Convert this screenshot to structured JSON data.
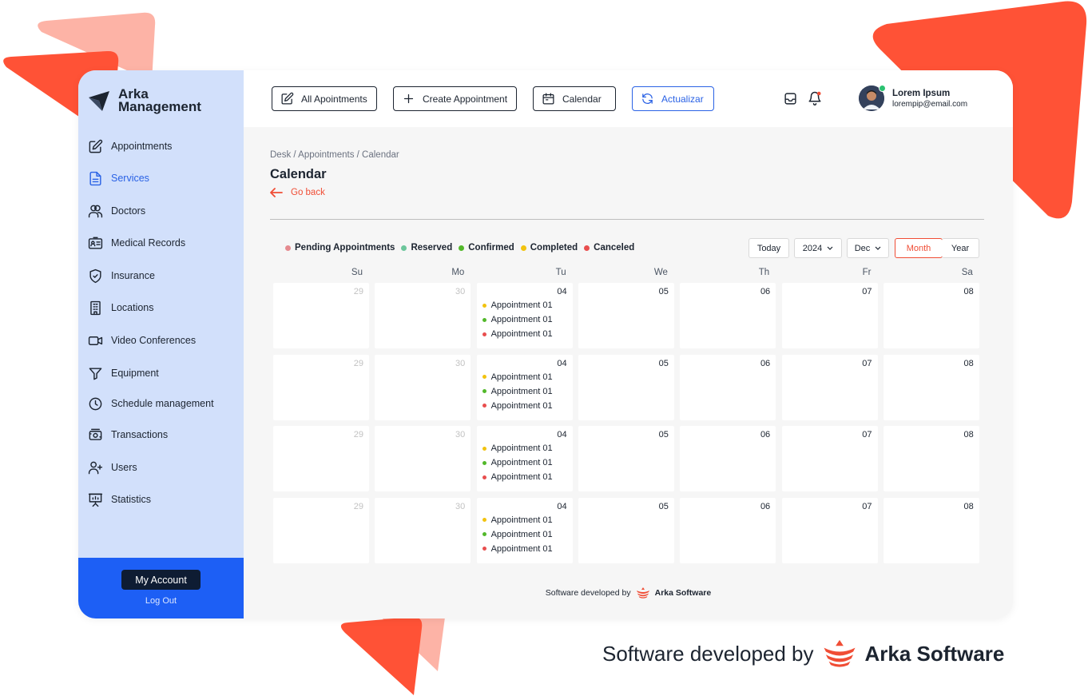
{
  "colors": {
    "accent": "#f04d35",
    "accent_light": "#fdb3a6",
    "sidebar_bg": "#d2e0fb",
    "primary_blue": "#1d5ff5",
    "pending": "#e58a8f",
    "reserved": "#6cc69b",
    "confirmed": "#52b82a",
    "completed": "#f2c30f",
    "canceled": "#e84e4e"
  },
  "sidebar": {
    "brand": "Arka Management",
    "items": [
      {
        "label": "Appointments",
        "icon": "edit-icon"
      },
      {
        "label": "Services",
        "icon": "document-icon",
        "active": true
      },
      {
        "label": "Doctors",
        "icon": "users-icon"
      },
      {
        "label": "Medical Records",
        "icon": "id-card-icon"
      },
      {
        "label": "Insurance",
        "icon": "shield-icon"
      },
      {
        "label": "Locations",
        "icon": "building-icon"
      },
      {
        "label": "Video Conferences",
        "icon": "video-icon"
      },
      {
        "label": "Equipment",
        "icon": "filter-icon"
      },
      {
        "label": "Schedule management",
        "icon": "clock-icon"
      },
      {
        "label": "Transactions",
        "icon": "money-icon"
      },
      {
        "label": "Users",
        "icon": "user-plus-icon"
      },
      {
        "label": "Statistics",
        "icon": "presentation-icon"
      }
    ],
    "account_label": "My Account",
    "logout_label": "Log Out"
  },
  "toolbar": {
    "all_label": "All Apointments",
    "create_label": "Create Appointment",
    "calendar_label": "Calendar",
    "refresh_label": "Actualizar"
  },
  "user": {
    "name": "Lorem Ipsum",
    "email": "lorempip@email.com"
  },
  "page": {
    "breadcrumb": "Desk / Appointments / Calendar",
    "title": "Calendar",
    "back_label": "Go back"
  },
  "legend": [
    {
      "label": "Pending Appointments",
      "color": "#e58a8f"
    },
    {
      "label": "Reserved",
      "color": "#6cc69b"
    },
    {
      "label": "Confirmed",
      "color": "#52b82a"
    },
    {
      "label": "Completed",
      "color": "#f2c30f"
    },
    {
      "label": "Canceled",
      "color": "#e84e4e"
    }
  ],
  "controls": {
    "today": "Today",
    "year": "2024",
    "month": "Dec",
    "view_month": "Month",
    "view_year": "Year",
    "selected_view": "Month"
  },
  "calendar": {
    "weekdays": [
      "Su",
      "Mo",
      "Tu",
      "We",
      "Th",
      "Fr",
      "Sa"
    ],
    "weeks": [
      [
        {
          "day": "29",
          "muted": true,
          "appointments": []
        },
        {
          "day": "30",
          "muted": true,
          "appointments": []
        },
        {
          "day": "04",
          "appointments": [
            {
              "label": "Appointment 01",
              "color": "#f2c30f"
            },
            {
              "label": "Appointment 01",
              "color": "#52b82a"
            },
            {
              "label": "Appointment 01",
              "color": "#e84e4e"
            }
          ]
        },
        {
          "day": "05",
          "appointments": []
        },
        {
          "day": "06",
          "appointments": []
        },
        {
          "day": "07",
          "appointments": []
        },
        {
          "day": "08",
          "appointments": []
        }
      ],
      [
        {
          "day": "29",
          "muted": true,
          "appointments": []
        },
        {
          "day": "30",
          "muted": true,
          "appointments": []
        },
        {
          "day": "04",
          "appointments": [
            {
              "label": "Appointment 01",
              "color": "#f2c30f"
            },
            {
              "label": "Appointment 01",
              "color": "#52b82a"
            },
            {
              "label": "Appointment 01",
              "color": "#e84e4e"
            }
          ]
        },
        {
          "day": "05",
          "appointments": []
        },
        {
          "day": "06",
          "appointments": []
        },
        {
          "day": "07",
          "appointments": []
        },
        {
          "day": "08",
          "appointments": []
        }
      ],
      [
        {
          "day": "29",
          "muted": true,
          "appointments": []
        },
        {
          "day": "30",
          "muted": true,
          "appointments": []
        },
        {
          "day": "04",
          "appointments": [
            {
              "label": "Appointment 01",
              "color": "#f2c30f"
            },
            {
              "label": "Appointment 01",
              "color": "#52b82a"
            },
            {
              "label": "Appointment 01",
              "color": "#e84e4e"
            }
          ]
        },
        {
          "day": "05",
          "appointments": []
        },
        {
          "day": "06",
          "appointments": []
        },
        {
          "day": "07",
          "appointments": []
        },
        {
          "day": "08",
          "appointments": []
        }
      ],
      [
        {
          "day": "29",
          "muted": true,
          "appointments": []
        },
        {
          "day": "30",
          "muted": true,
          "appointments": []
        },
        {
          "day": "04",
          "appointments": [
            {
              "label": "Appointment 01",
              "color": "#f2c30f"
            },
            {
              "label": "Appointment 01",
              "color": "#52b82a"
            },
            {
              "label": "Appointment 01",
              "color": "#e84e4e"
            }
          ]
        },
        {
          "day": "05",
          "appointments": []
        },
        {
          "day": "06",
          "appointments": []
        },
        {
          "day": "07",
          "appointments": []
        },
        {
          "day": "08",
          "appointments": []
        }
      ]
    ]
  },
  "footer": {
    "small_prefix": "Software developed by",
    "small_brand": "Arka Software",
    "big_prefix": "Software developed by",
    "big_brand": "Arka Software"
  }
}
